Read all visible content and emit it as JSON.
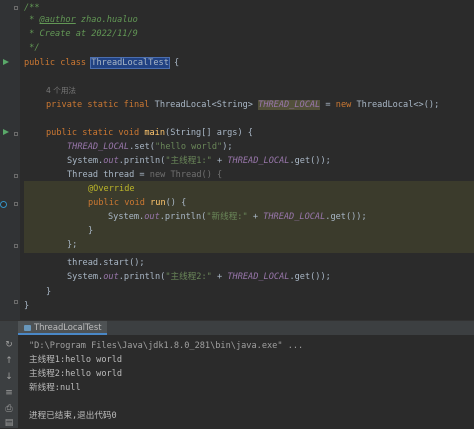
{
  "code": {
    "javadoc_open": "/**",
    "javadoc_author_prefix": " * ",
    "javadoc_author_tag": "@author",
    "javadoc_author_value": " zhao.hualuo",
    "javadoc_create": " * Create at 2022/11/9",
    "javadoc_close": " */",
    "class_kw": "public class ",
    "class_name": "ThreadLocalTest",
    "class_open": " {",
    "usage_hint": "4 个用法",
    "field_kw": "private static final ",
    "field_type": "ThreadLocal<String> ",
    "field_name": "THREAD_LOCAL",
    "field_assign": " = ",
    "field_new": "new ",
    "field_init": "ThreadLocal<>();",
    "main_kw": "public static void ",
    "main_name": "main",
    "main_sig": "(String[] args) {",
    "set_field": "THREAD_LOCAL",
    "set_call": ".set(",
    "set_arg": "\"hello world\"",
    "set_end": ");",
    "println1_pre": "System.",
    "println1_out": "out",
    "println1_mid": ".println(",
    "println1_str": "\"主线程1:\"",
    "println1_plus": " + ",
    "println1_field": "THREAD_LOCAL",
    "println1_end": ".get());",
    "thread_decl": "Thread thread = ",
    "thread_new": "new Thread() {",
    "override": "@Override",
    "run_kw": "public void ",
    "run_name": "run",
    "run_sig": "() {",
    "println_new_pre": "System.",
    "println_new_out": "out",
    "println_new_mid": ".println(",
    "println_new_str": "\"新线程:\"",
    "println_new_plus": " + ",
    "println_new_field": "THREAD_LOCAL",
    "println_new_end": ".get());",
    "close_brace_inner": "}",
    "close_anon": "};",
    "start_call": "thread.start();",
    "println2_pre": "System.",
    "println2_out": "out",
    "println2_mid": ".println(",
    "println2_str": "\"主线程2:\"",
    "println2_plus": " + ",
    "println2_field": "THREAD_LOCAL",
    "println2_end": ".get());",
    "close_main": "}",
    "close_class": "}"
  },
  "run_panel": {
    "tab_label": "ThreadLocalTest",
    "command": "\"D:\\Program Files\\Java\\jdk1.8.0_281\\bin\\java.exe\" ...",
    "out1": "主线程1:hello world",
    "out2": "主线程2:hello world",
    "out3": "新线程:null",
    "exit": "进程已结束,退出代码0",
    "toolbar_icons": [
      "rerun-icon",
      "stop-icon",
      "scroll-down-icon",
      "wrap-icon",
      "print-icon",
      "delete-icon"
    ]
  },
  "colors": {
    "background": "#2b2b2b",
    "keyword": "#cc7832",
    "string": "#6a8759",
    "field": "#9876aa",
    "method": "#ffc66d",
    "annotation": "#bbb529"
  }
}
